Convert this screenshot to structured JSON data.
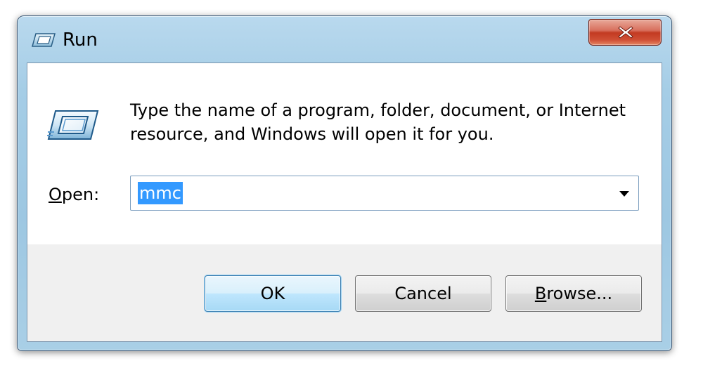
{
  "window": {
    "title": "Run",
    "close_glyph": "✕"
  },
  "dialog": {
    "description": "Type the name of a program, folder, document, or Internet resource, and Windows will open it for you.",
    "open_label_mnemonic": "O",
    "open_label_rest": "pen:",
    "open_value": "mmc"
  },
  "buttons": {
    "ok_label": "OK",
    "cancel_label": "Cancel",
    "browse_label_mnemonic": "B",
    "browse_label_rest": "rowse..."
  },
  "icons": {
    "title_icon": "run-icon",
    "large_icon": "run-icon",
    "dropdown_icon": "chevron-down-icon",
    "close_icon": "close-icon"
  },
  "colors": {
    "title_bar": "#a5cde6",
    "close_button": "#c33a22",
    "selection_highlight": "#3399ff",
    "ok_button_border": "#3c7fb1"
  }
}
